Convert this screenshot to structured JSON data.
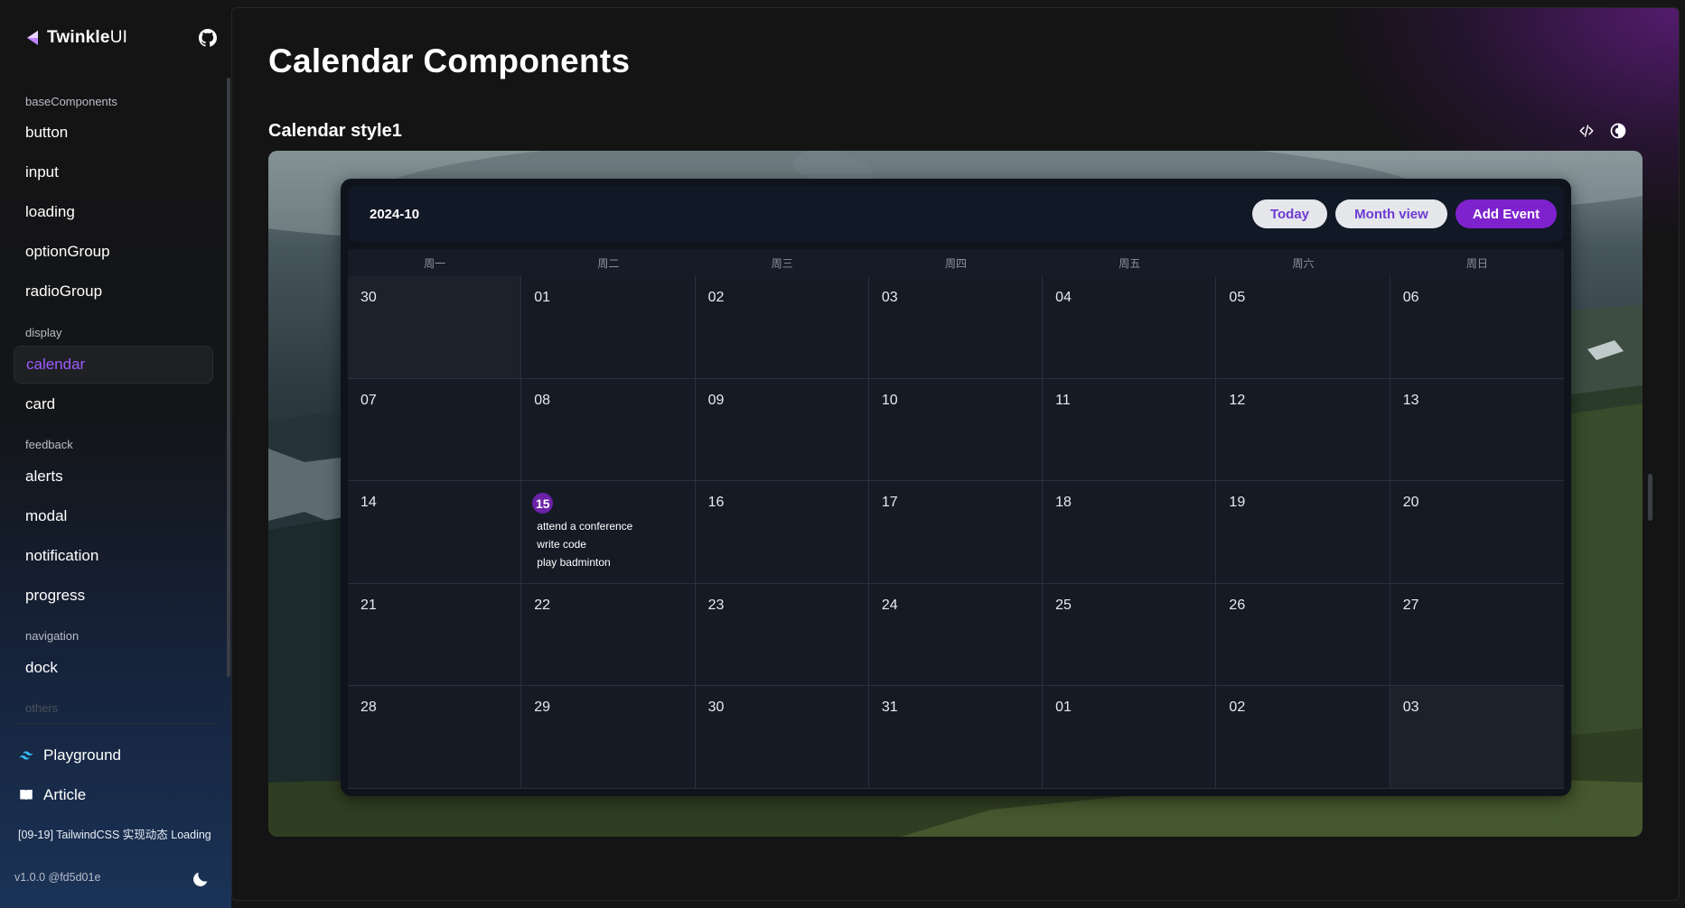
{
  "brand": {
    "name_bold": "Twinkle",
    "name_light": "UI"
  },
  "sidebar": {
    "groups": [
      {
        "label": "baseComponents",
        "items": [
          "button",
          "input",
          "loading",
          "optionGroup",
          "radioGroup"
        ]
      },
      {
        "label": "display",
        "items": [
          "calendar",
          "card"
        ]
      },
      {
        "label": "feedback",
        "items": [
          "alerts",
          "modal",
          "notification",
          "progress"
        ]
      },
      {
        "label": "navigation",
        "items": [
          "dock"
        ]
      },
      {
        "label": "others",
        "items": []
      }
    ],
    "active_item": "calendar",
    "playground": "Playground",
    "article": "Article",
    "article_link": "[09-19] TailwindCSS 实现动态 Loading",
    "version": "v1.0.0 @fd5d01e"
  },
  "main": {
    "page_title": "Calendar Components",
    "section_title": "Calendar style1"
  },
  "calendar": {
    "month": "2024-10",
    "buttons": {
      "today": "Today",
      "month_view": "Month view",
      "add_event": "Add Event"
    },
    "weekdays": [
      "周一",
      "周二",
      "周三",
      "周四",
      "周五",
      "周六",
      "周日"
    ],
    "days": [
      "30",
      "01",
      "02",
      "03",
      "04",
      "05",
      "06",
      "07",
      "08",
      "09",
      "10",
      "11",
      "12",
      "13",
      "14",
      "15",
      "16",
      "17",
      "18",
      "19",
      "20",
      "21",
      "22",
      "23",
      "24",
      "25",
      "26",
      "27",
      "28",
      "29",
      "30",
      "31",
      "01",
      "02",
      "03"
    ],
    "today": "15",
    "events": [
      "attend a conference",
      "write code",
      "play badminton"
    ],
    "colors": {
      "accent": "#7e22ce",
      "today_badge": "#6b21a8",
      "active_nav": "#9b5cff"
    }
  }
}
